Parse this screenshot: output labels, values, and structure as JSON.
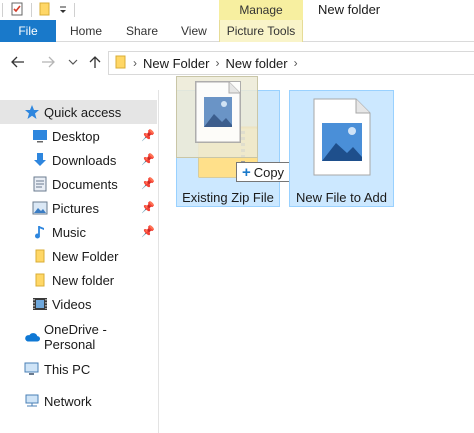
{
  "window": {
    "title": "New folder",
    "contextual_group": "Manage"
  },
  "quick_access_toolbar": {
    "items": [
      "properties-icon",
      "folder-icon",
      "dropdown-icon"
    ]
  },
  "ribbon": {
    "tabs": [
      {
        "label": "File",
        "active": true
      },
      {
        "label": "Home"
      },
      {
        "label": "Share"
      },
      {
        "label": "View"
      },
      {
        "label": "Picture Tools"
      }
    ]
  },
  "address_bar": {
    "path": [
      "New Folder",
      "New folder"
    ]
  },
  "sidebar": {
    "quick_access": "Quick access",
    "items": [
      {
        "label": "Desktop",
        "icon": "desktop-icon",
        "pinned": true
      },
      {
        "label": "Downloads",
        "icon": "download-icon",
        "pinned": true
      },
      {
        "label": "Documents",
        "icon": "documents-icon",
        "pinned": true
      },
      {
        "label": "Pictures",
        "icon": "pictures-icon",
        "pinned": true
      },
      {
        "label": "Music",
        "icon": "music-icon",
        "pinned": true
      },
      {
        "label": "New Folder",
        "icon": "folder-icon"
      },
      {
        "label": "New folder",
        "icon": "folder-icon"
      },
      {
        "label": "Videos",
        "icon": "videos-icon"
      }
    ],
    "onedrive": "OneDrive - Personal",
    "this_pc": "This PC",
    "network": "Network"
  },
  "files": [
    {
      "name": "Existing Zip File",
      "icon": "zip-folder-icon",
      "selected": true
    },
    {
      "name": "New File to Add",
      "icon": "image-file-icon",
      "selected": true
    }
  ],
  "drag": {
    "tooltip": "Copy",
    "ghost_icon": "image-file-icon"
  },
  "colors": {
    "accent": "#1979ca",
    "manage": "#f7efa0",
    "selection": "#cce8ff",
    "selection_border": "#99d1ff"
  }
}
